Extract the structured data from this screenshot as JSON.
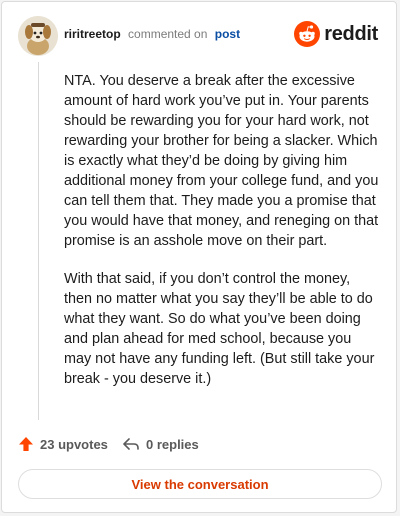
{
  "comment": {
    "author": "riritreetop",
    "action_text": "commented on",
    "post_link": "post",
    "paragraphs": [
      "NTA. You deserve a break after the excessive amount of hard work you’ve put in. Your parents should be rewarding you for your hard work, not rewarding your brother for being a slacker. Which is exactly what they’d be doing by giving him additional money from your college fund, and you can tell them that. They made you a promise that you would have that money, and reneging on that promise is an asshole move on their part.",
      "With that said, if you don’t control the money, then no matter what you say they’ll be able to do what they want. So do what you’ve been doing and plan ahead for med school, because you may not have any funding left. (But still take your break - you deserve it.)"
    ]
  },
  "brand": {
    "wordmark": "reddit",
    "color": "#ff4500"
  },
  "actions": {
    "upvotes": "23 upvotes",
    "replies": "0 replies"
  },
  "cta": {
    "label": "View the conversation",
    "color": "#d93a00"
  },
  "icons": {
    "avatar": "snoo-avatar-icon",
    "upvote": "upvote-arrow-icon",
    "reply": "reply-arrow-icon",
    "logo": "reddit-snoo-icon"
  }
}
